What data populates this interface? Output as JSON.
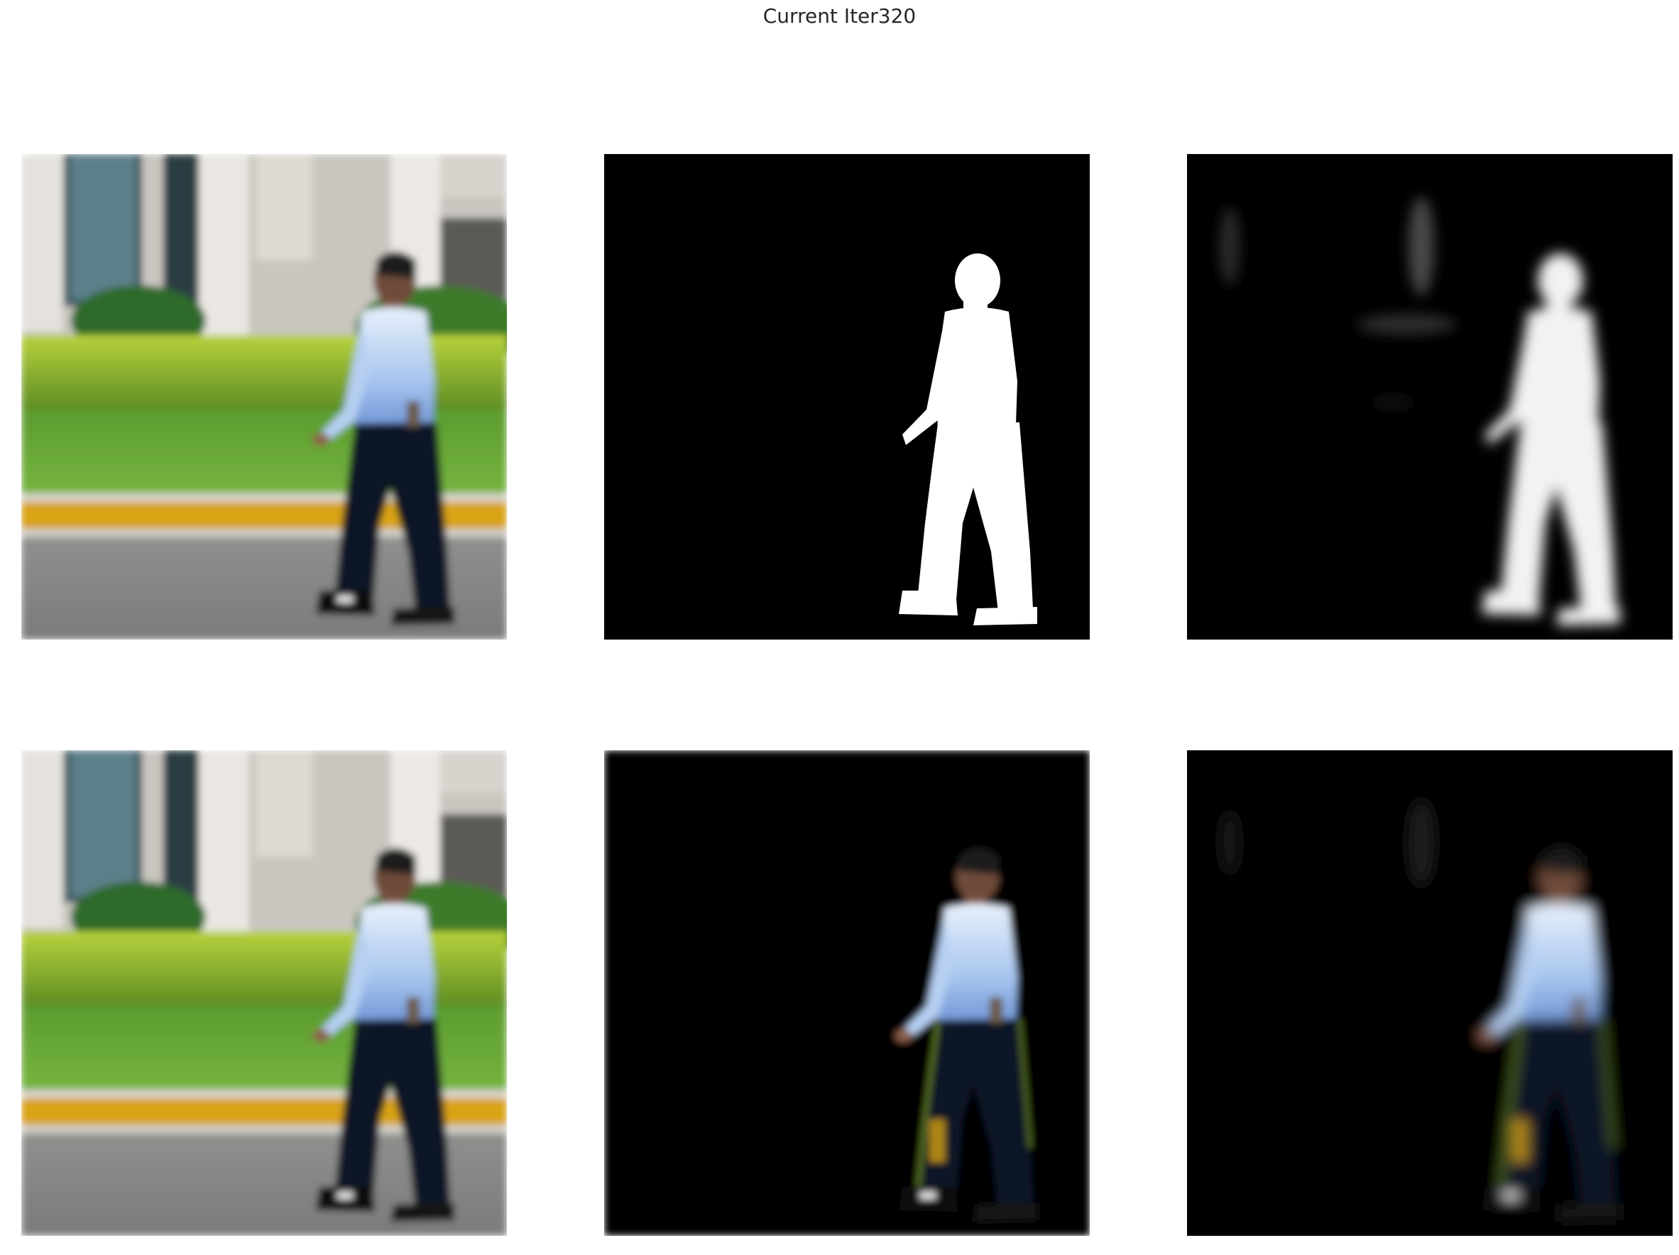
{
  "figure": {
    "title": "Current Iter320"
  },
  "panels": [
    {
      "row": 1,
      "col": 1,
      "kind": "input-image"
    },
    {
      "row": 1,
      "col": 2,
      "kind": "ground-truth-mask"
    },
    {
      "row": 1,
      "col": 3,
      "kind": "predicted-mask"
    },
    {
      "row": 2,
      "col": 1,
      "kind": "input-image"
    },
    {
      "row": 2,
      "col": 2,
      "kind": "ground-truth-cutout"
    },
    {
      "row": 2,
      "col": 3,
      "kind": "predicted-cutout"
    }
  ]
}
